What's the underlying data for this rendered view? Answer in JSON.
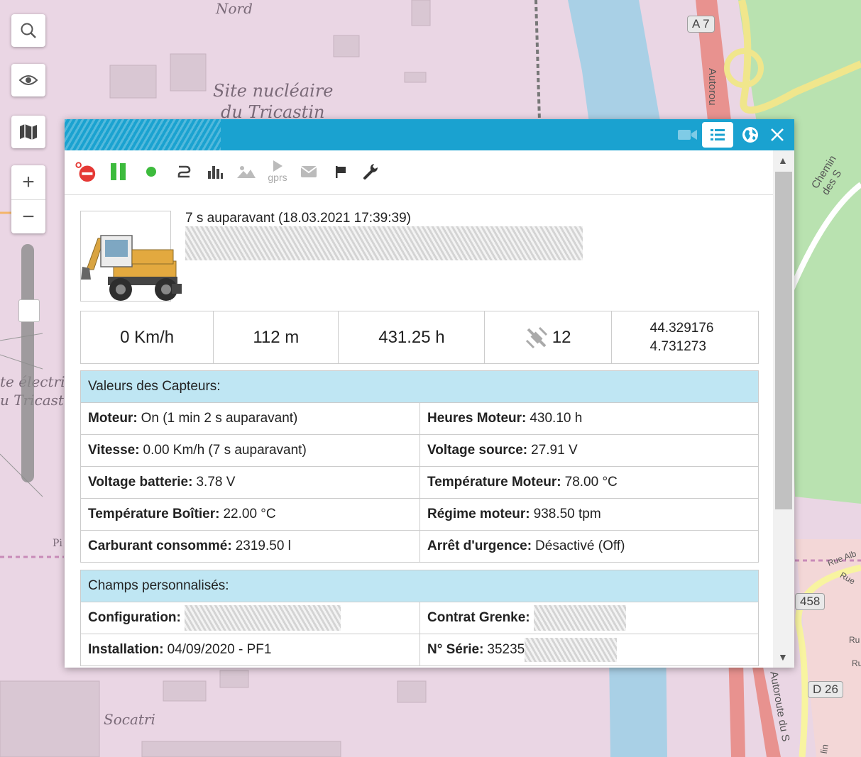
{
  "map": {
    "labels": {
      "nord": "Nord",
      "site1": "Site nucléaire",
      "site2": "du Tricastin",
      "elec1": "te électriq",
      "elec2": "u Tricastin",
      "socatri": "Socatri",
      "chemin": "Chemin des S",
      "autoroute_top": "Autorou",
      "autoroute_bottom": "Autoroute du S",
      "rue_alb": "Rue Alb",
      "rue": "Rue",
      "ru": "Ru",
      "ru2": "Ru",
      "p": "Pi",
      "lin": "lin"
    },
    "shields": {
      "a7": "A 7",
      "r458": "458",
      "d26": "D 26"
    }
  },
  "controls": {
    "search_icon": "search-icon",
    "eye_icon": "eye-icon",
    "map_icon": "map-icon",
    "zoom_in": "+",
    "zoom_out": "−",
    "zoom_level": 0.27
  },
  "popup": {
    "title_buttons": [
      "video-icon",
      "list-icon",
      "globe-icon",
      "close-icon"
    ],
    "toolbar": {
      "gprs": "gprs",
      "icons": [
        "stop-engine-icon",
        "pause-icon",
        "status-dot-icon",
        "route-icon",
        "chart-icon",
        "image-icon",
        "gprs-play-icon",
        "mail-icon",
        "flag-icon",
        "wrench-icon"
      ]
    },
    "last_update": "7 s auparavant (18.03.2021 17:39:39)",
    "stats": {
      "speed": "0 Km/h",
      "altitude": "112 m",
      "hours": "431.25 h",
      "satellites": "12",
      "lat": "44.329176",
      "lon": "4.731273"
    },
    "sensors": {
      "title": "Valeurs des Capteurs:",
      "rows": [
        [
          {
            "label": "Moteur:",
            "value": "On (1 min 2 s auparavant)"
          },
          {
            "label": "Heures Moteur:",
            "value": "430.10 h"
          }
        ],
        [
          {
            "label": "Vitesse:",
            "value": "0.00 Km/h (7 s auparavant)"
          },
          {
            "label": "Voltage source:",
            "value": "27.91 V"
          }
        ],
        [
          {
            "label": "Voltage batterie:",
            "value": "3.78 V"
          },
          {
            "label": "Température Moteur:",
            "value": "78.00 °C"
          }
        ],
        [
          {
            "label": "Température Boîtier:",
            "value": "22.00 °C"
          },
          {
            "label": "Régime moteur:",
            "value": "938.50 tpm"
          }
        ],
        [
          {
            "label": "Carburant consommé:",
            "value": "2319.50 l"
          },
          {
            "label": "Arrêt d'urgence:",
            "value": "Désactivé (Off)"
          }
        ]
      ]
    },
    "custom": {
      "title": "Champs personnalisés:",
      "rows": [
        [
          {
            "label": "Configuration:",
            "value": ""
          },
          {
            "label": "Contrat Grenke:",
            "value": ""
          }
        ],
        [
          {
            "label": "Installation:",
            "value": "04/09/2020 - PF1"
          },
          {
            "label": "N° Série:",
            "value": "35235"
          }
        ]
      ]
    }
  }
}
